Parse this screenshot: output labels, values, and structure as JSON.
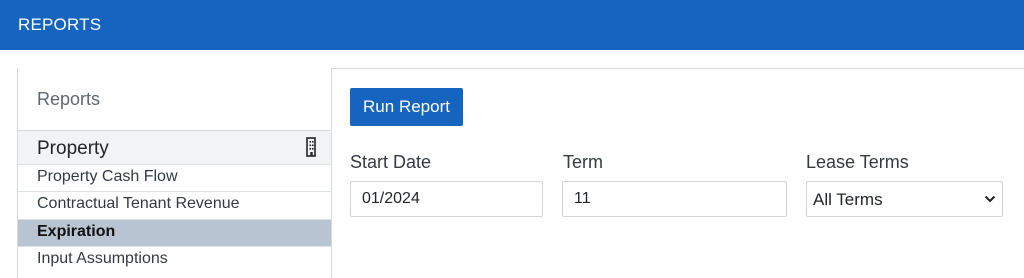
{
  "header": {
    "title": "REPORTS"
  },
  "sidebar": {
    "title": "Reports",
    "group": {
      "label": "Property",
      "icon": "building-icon"
    },
    "items": [
      {
        "label": "Property Cash Flow",
        "active": false
      },
      {
        "label": "Contractual Tenant Revenue",
        "active": false
      },
      {
        "label": "Expiration",
        "active": true
      },
      {
        "label": "Input Assumptions",
        "active": false
      }
    ]
  },
  "main": {
    "run_button": "Run Report",
    "start_date": {
      "label": "Start Date",
      "value": "01/2024"
    },
    "term": {
      "label": "Term",
      "value": "11"
    },
    "lease_terms": {
      "label": "Lease Terms",
      "value": "All Terms",
      "icon": "chevron-down-icon"
    }
  },
  "colors": {
    "brand": "#1565c0",
    "active_item": "#b8c4d1"
  }
}
